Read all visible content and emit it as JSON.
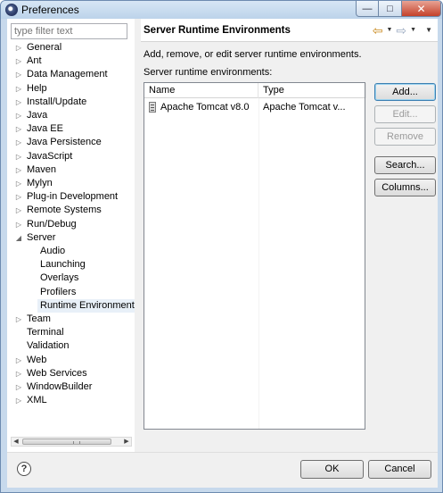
{
  "window": {
    "title": "Preferences"
  },
  "filter": {
    "placeholder": "type filter text"
  },
  "tree": {
    "items": [
      {
        "label": "General",
        "expandable": true
      },
      {
        "label": "Ant",
        "expandable": true
      },
      {
        "label": "Data Management",
        "expandable": true
      },
      {
        "label": "Help",
        "expandable": true
      },
      {
        "label": "Install/Update",
        "expandable": true
      },
      {
        "label": "Java",
        "expandable": true
      },
      {
        "label": "Java EE",
        "expandable": true
      },
      {
        "label": "Java Persistence",
        "expandable": true
      },
      {
        "label": "JavaScript",
        "expandable": true
      },
      {
        "label": "Maven",
        "expandable": true
      },
      {
        "label": "Mylyn",
        "expandable": true
      },
      {
        "label": "Plug-in Development",
        "expandable": true
      },
      {
        "label": "Remote Systems",
        "expandable": true
      },
      {
        "label": "Run/Debug",
        "expandable": true
      },
      {
        "label": "Server",
        "expandable": true,
        "expanded": true
      },
      {
        "label": "Audio",
        "child": true
      },
      {
        "label": "Launching",
        "child": true
      },
      {
        "label": "Overlays",
        "child": true
      },
      {
        "label": "Profilers",
        "child": true
      },
      {
        "label": "Runtime Environment",
        "child": true,
        "selected": true
      },
      {
        "label": "Team",
        "expandable": true
      },
      {
        "label": "Terminal",
        "expandable": false
      },
      {
        "label": "Validation",
        "expandable": false
      },
      {
        "label": "Web",
        "expandable": true
      },
      {
        "label": "Web Services",
        "expandable": true
      },
      {
        "label": "WindowBuilder",
        "expandable": true
      },
      {
        "label": "XML",
        "expandable": true
      }
    ]
  },
  "page": {
    "title": "Server Runtime Environments",
    "description": "Add, remove, or edit server runtime environments.",
    "list_label": "Server runtime environments:"
  },
  "table": {
    "columns": [
      "Name",
      "Type"
    ],
    "rows": [
      {
        "name": "Apache Tomcat v8.0",
        "type": "Apache Tomcat v..."
      }
    ]
  },
  "buttons": {
    "add": "Add...",
    "edit": "Edit...",
    "remove": "Remove",
    "search": "Search...",
    "columns": "Columns...",
    "ok": "OK",
    "cancel": "Cancel"
  },
  "icons": {
    "back": "back-arrow-icon",
    "forward": "forward-arrow-icon",
    "help": "help-icon",
    "server": "server-icon"
  },
  "colors": {
    "nav_arrow": "#c8871a",
    "default_button_border": "#3c7fb1",
    "close_button": "#c4412a"
  }
}
